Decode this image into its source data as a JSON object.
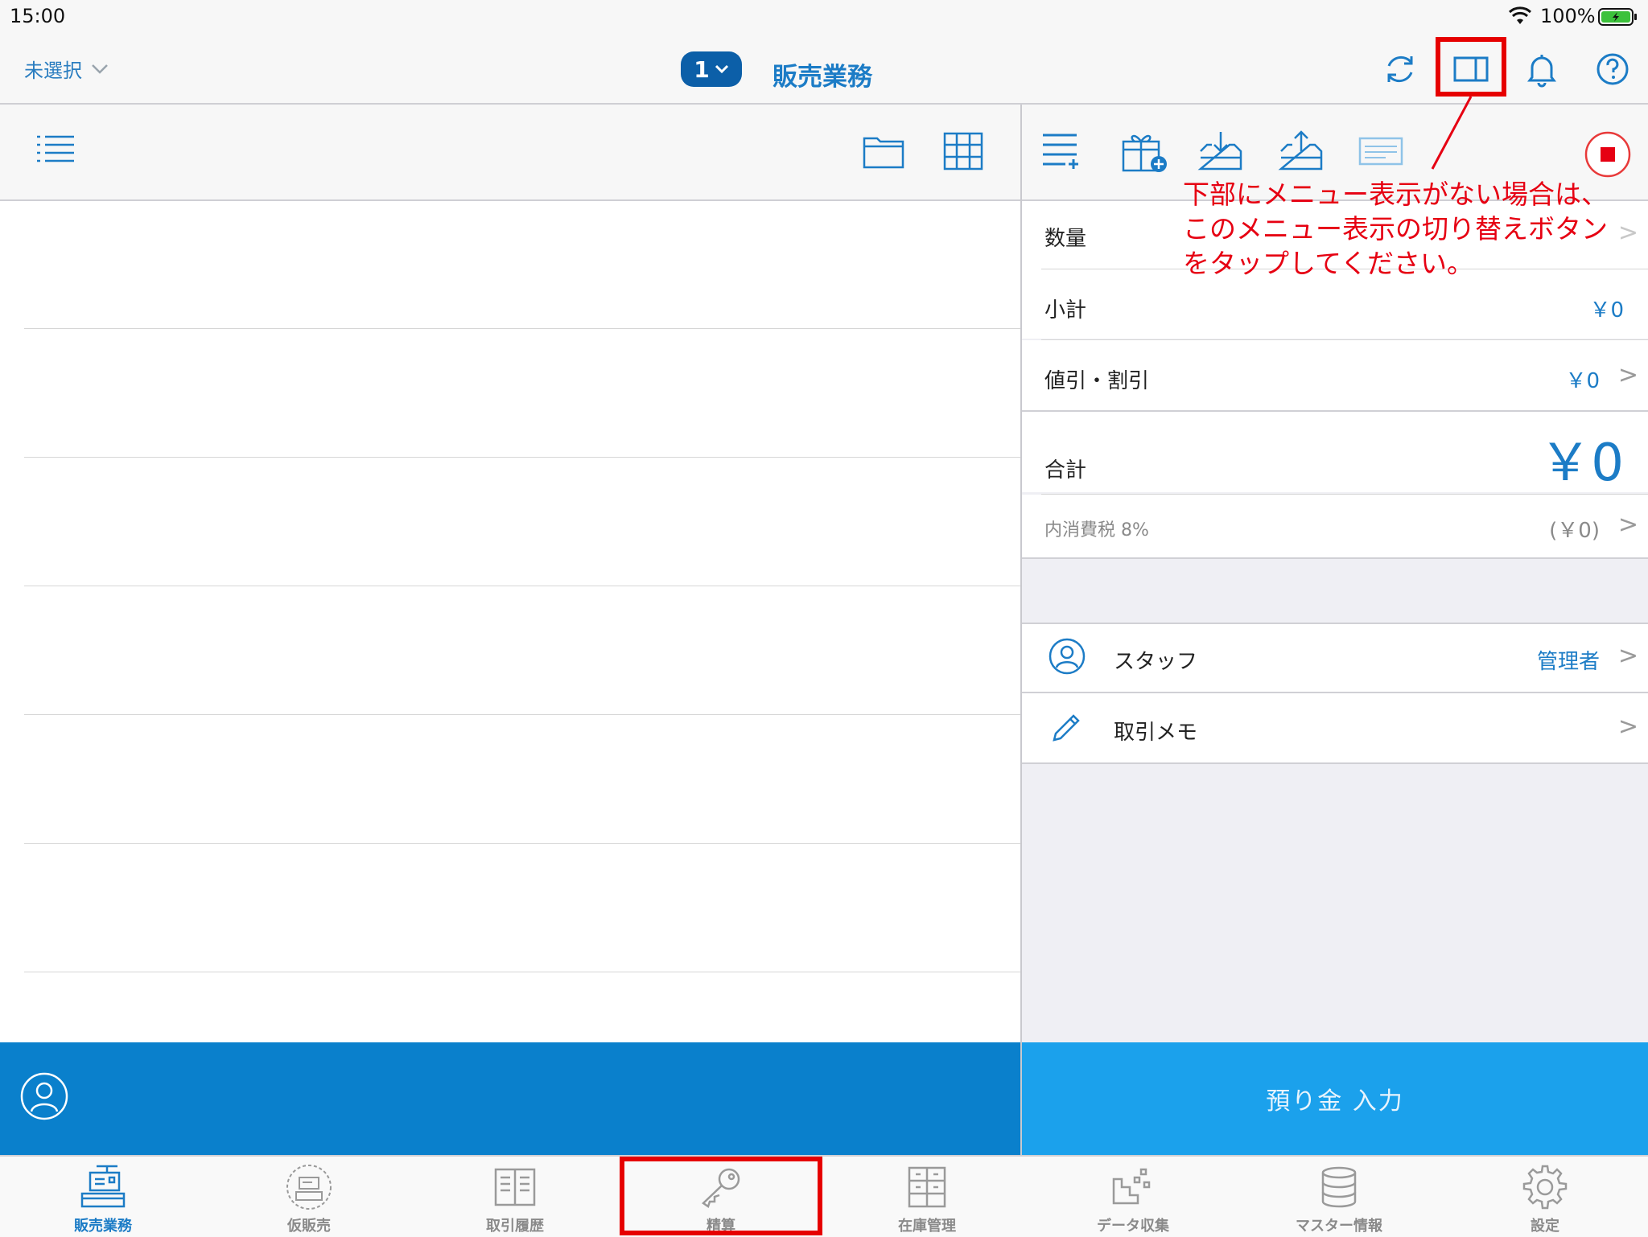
{
  "status_bar": {
    "time": "15:00",
    "battery": "100%"
  },
  "nav": {
    "store_select": "未選択",
    "register_number": "1",
    "title": "販売業務"
  },
  "summary": {
    "quantity_label": "数量",
    "subtotal_label": "小計",
    "subtotal_value": "￥0",
    "discount_label": "値引・割引",
    "discount_value": "￥0",
    "total_label": "合計",
    "total_value": "￥0",
    "tax_label": "内消費税 8%",
    "tax_value": "(￥0)",
    "staff_label": "スタッフ",
    "staff_value": "管理者",
    "memo_label": "取引メモ"
  },
  "deposit_button": "預り金 入力",
  "annotation": "下部にメニュー表示がない場合は、\nこのメニュー表示の切り替えボタン\nをタップしてください。",
  "tabs": [
    {
      "label": "販売業務",
      "icon": "register-icon",
      "active": true
    },
    {
      "label": "仮販売",
      "icon": "temp-register-icon",
      "active": false
    },
    {
      "label": "取引履歴",
      "icon": "book-icon",
      "active": false
    },
    {
      "label": "精算",
      "icon": "key-icon",
      "active": false
    },
    {
      "label": "在庫管理",
      "icon": "cabinet-icon",
      "active": false
    },
    {
      "label": "データ収集",
      "icon": "data-blocks-icon",
      "active": false
    },
    {
      "label": "マスター情報",
      "icon": "database-icon",
      "active": false
    },
    {
      "label": "設定",
      "icon": "gear-icon",
      "active": false
    }
  ],
  "colors": {
    "accent": "#1c7cc6",
    "action_bar": "#0a80cc",
    "deposit": "#1ba1ec",
    "highlight": "#e60000"
  }
}
